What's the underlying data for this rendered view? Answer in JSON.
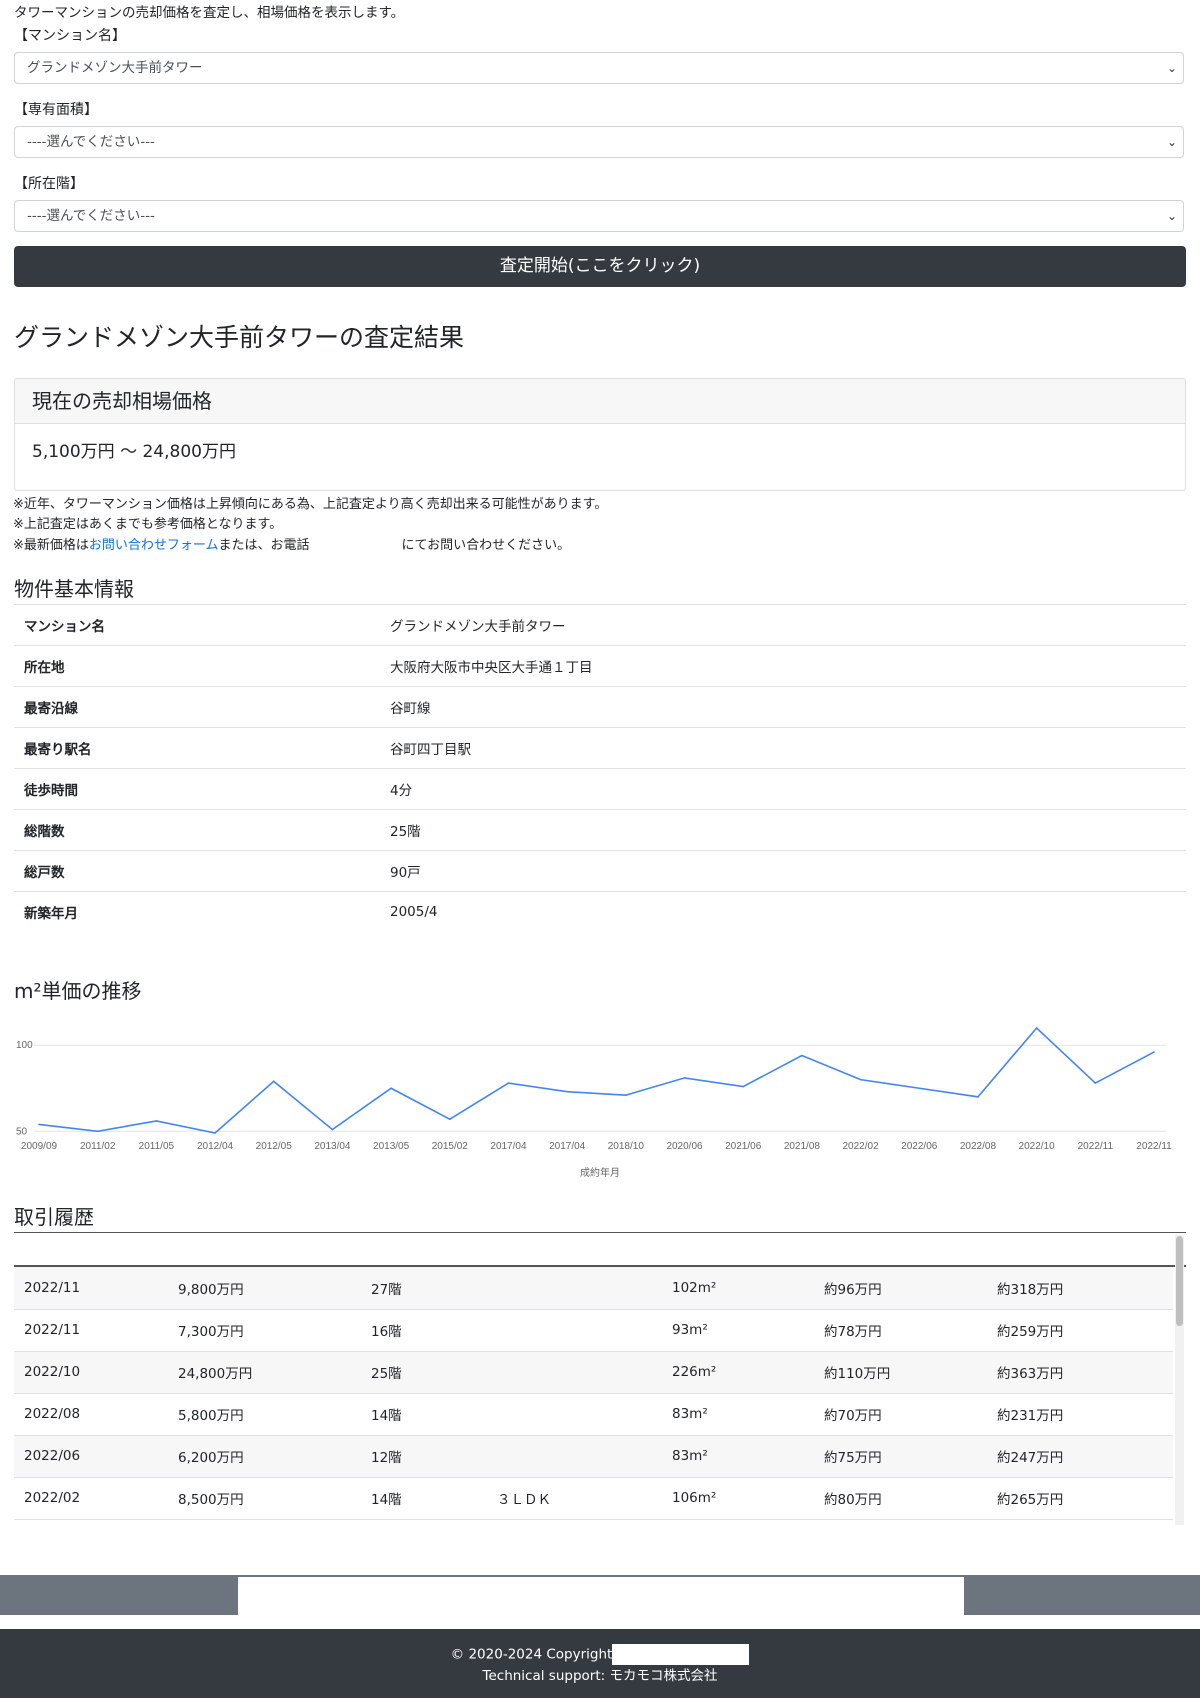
{
  "intro": "タワーマンションの売却価格を査定し、相場価格を表示します。",
  "form": {
    "mansion_label": "【マンション名】",
    "mansion_value": "グランドメゾン大手前タワー",
    "area_label": "【専有面積】",
    "area_value": "----選んでください---",
    "floor_label": "【所在階】",
    "floor_value": "----選んでください---",
    "submit_label": "査定開始(ここをクリック)"
  },
  "result": {
    "title": "グランドメゾン大手前タワーの査定結果",
    "card_title": "現在の売却相場価格",
    "price_range": "5,100万円 〜 24,800万円"
  },
  "notes": {
    "n1": "※近年、タワーマンション価格は上昇傾向にある為、上記査定より高く売却出来る可能性があります。",
    "n2": "※上記査定はあくまでも参考価格となります。",
    "n3_pre": "※最新価格は",
    "n3_link": "お問い合わせフォーム",
    "n3_mid": "または、お電話",
    "n3_post": "にてお問い合わせください。"
  },
  "info": {
    "title": "物件基本情報",
    "rows": [
      {
        "k": "マンション名",
        "v": "グランドメゾン大手前タワー"
      },
      {
        "k": "所在地",
        "v": "大阪府大阪市中央区大手通１丁目"
      },
      {
        "k": "最寄沿線",
        "v": "谷町線"
      },
      {
        "k": "最寄り駅名",
        "v": "谷町四丁目駅"
      },
      {
        "k": "徒歩時間",
        "v": "4分"
      },
      {
        "k": "総階数",
        "v": "25階"
      },
      {
        "k": "総戸数",
        "v": "90戸"
      },
      {
        "k": "新築年月",
        "v": "2005/4"
      }
    ]
  },
  "chart_title": "m²単価の推移",
  "chart_data": {
    "type": "line",
    "title": "m²単価の推移",
    "xlabel": "成約年月",
    "ylabel": "",
    "x": [
      "2009/09",
      "2011/02",
      "2011/05",
      "2012/04",
      "2012/05",
      "2013/04",
      "2013/05",
      "2015/02",
      "2017/04",
      "2017/04",
      "2018/10",
      "2020/06",
      "2021/06",
      "2021/08",
      "2022/02",
      "2022/06",
      "2022/08",
      "2022/10",
      "2022/11",
      "2022/11"
    ],
    "series": [
      {
        "values": [
          54,
          50,
          56,
          49,
          79,
          51,
          75,
          57,
          78,
          73,
          71,
          81,
          76,
          94,
          80,
          75,
          70,
          110,
          78,
          96
        ]
      }
    ],
    "yticks": [
      50,
      100
    ],
    "ylim": [
      49,
      110
    ],
    "grid": true,
    "color": "#4285f4"
  },
  "transactions": {
    "title": "取引履歴",
    "rows": [
      [
        "2022/11",
        "9,800万円",
        "27階",
        "",
        "102m²",
        "約96万円",
        "約318万円"
      ],
      [
        "2022/11",
        "7,300万円",
        "16階",
        "",
        "93m²",
        "約78万円",
        "約259万円"
      ],
      [
        "2022/10",
        "24,800万円",
        "25階",
        "",
        "226m²",
        "約110万円",
        "約363万円"
      ],
      [
        "2022/08",
        "5,800万円",
        "14階",
        "",
        "83m²",
        "約70万円",
        "約231万円"
      ],
      [
        "2022/06",
        "6,200万円",
        "12階",
        "",
        "83m²",
        "約75万円",
        "約247万円"
      ],
      [
        "2022/02",
        "8,500万円",
        "14階",
        "３ＬＤＫ",
        "106m²",
        "約80万円",
        "約265万円"
      ]
    ]
  },
  "footer": {
    "copyright": "© 2020-2024 Copyright",
    "support": "Technical support: モカモコ株式会社"
  }
}
